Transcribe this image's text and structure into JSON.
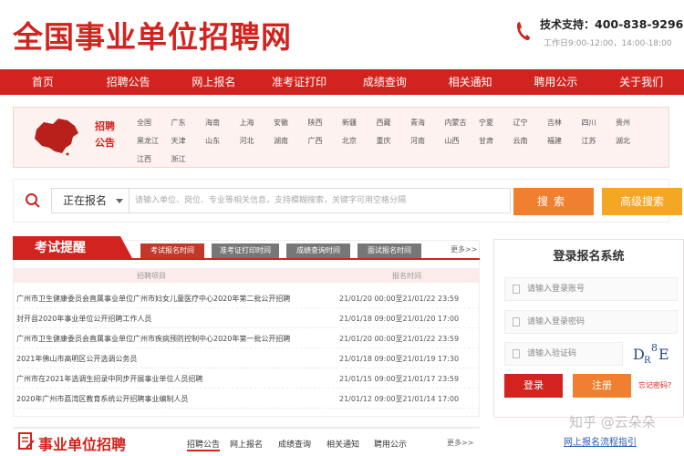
{
  "header": {
    "logo": "全国事业单位招聘网",
    "support_label": "技术支持：",
    "phone": "400-838-9296",
    "hours": "工作日9:00-12:00，14:00-18:00"
  },
  "nav": [
    "首页",
    "招聘公告",
    "网上报名",
    "准考证打印",
    "成绩查询",
    "相关通知",
    "聘用公示",
    "关于我们"
  ],
  "region": {
    "label": "招聘公告",
    "rows": [
      [
        "全国",
        "广东",
        "海南",
        "上海",
        "安徽",
        "陕西",
        "新疆",
        "西藏",
        "青海",
        "内蒙古",
        "宁夏",
        "辽宁",
        "吉林",
        "四川",
        "贵州"
      ],
      [
        "黑龙江",
        "天津",
        "山东",
        "河北",
        "湖南",
        "广西",
        "北京",
        "重庆",
        "河南",
        "山西",
        "甘肃",
        "云南",
        "福建",
        "江苏",
        "湖北"
      ],
      [
        "江西",
        "浙江"
      ]
    ]
  },
  "search": {
    "status": "正在报名",
    "placeholder": "请输入单位、岗位、专业等相关信息，支持模糊搜索，关键字可用空格分隔",
    "search_label": "搜索",
    "advanced_label": "高级搜索"
  },
  "exam": {
    "title": "考试提醒",
    "tabs": [
      "考试报名时间",
      "准考证打印时间",
      "成绩查询时间",
      "面试报名时间"
    ],
    "more": "更多>>",
    "col_project": "招聘项目",
    "col_time": "报名时间",
    "rows": [
      {
        "title": "广州市卫生健康委员会直属事业单位广州市妇女儿童医疗中心2020年第二批公开招聘",
        "time": "21/01/20 00:00至21/01/22 23:59"
      },
      {
        "title": "封开县2020年事业单位公开招聘工作人员",
        "time": "21/01/18 09:00至21/01/20 17:00"
      },
      {
        "title": "广州市卫生健康委员会直属事业单位广州市疾病预防控制中心2020年第一批公开招聘",
        "time": "21/01/20 00:00至21/01/22 23:59"
      },
      {
        "title": "2021年佛山市高明区公开选调公务员",
        "time": "21/01/18 09:00至21/01/19 17:30"
      },
      {
        "title": "广州市在2021年选调生招录中同步开展事业单位人员招聘",
        "time": "21/01/15 09:00至21/01/17 23:59"
      },
      {
        "title": "2020年广州市荔湾区教育系统公开招聘事业编制人员",
        "time": "21/01/12 09:00至21/01/14 17:00"
      }
    ]
  },
  "login": {
    "title": "登录报名系统",
    "account_placeholder": "请输入登录账号",
    "password_placeholder": "请输入登录密码",
    "captcha_placeholder": "请输入验证码",
    "captcha_text": "D₂⁸E",
    "login_label": "登录",
    "register_label": "注册",
    "forgot_label": "忘记密码?"
  },
  "bottom": {
    "title": "事业单位招聘",
    "tabs": [
      "招聘公告",
      "网上报名",
      "成绩查询",
      "相关通知",
      "聘用公示"
    ],
    "more": "更多>>",
    "flow_link": "网上报名流程指引",
    "watermark": "知乎 @云朵朵"
  },
  "colors": {
    "brand_red": "#d3231e",
    "orange": "#f08030",
    "amber": "#f5a623"
  }
}
